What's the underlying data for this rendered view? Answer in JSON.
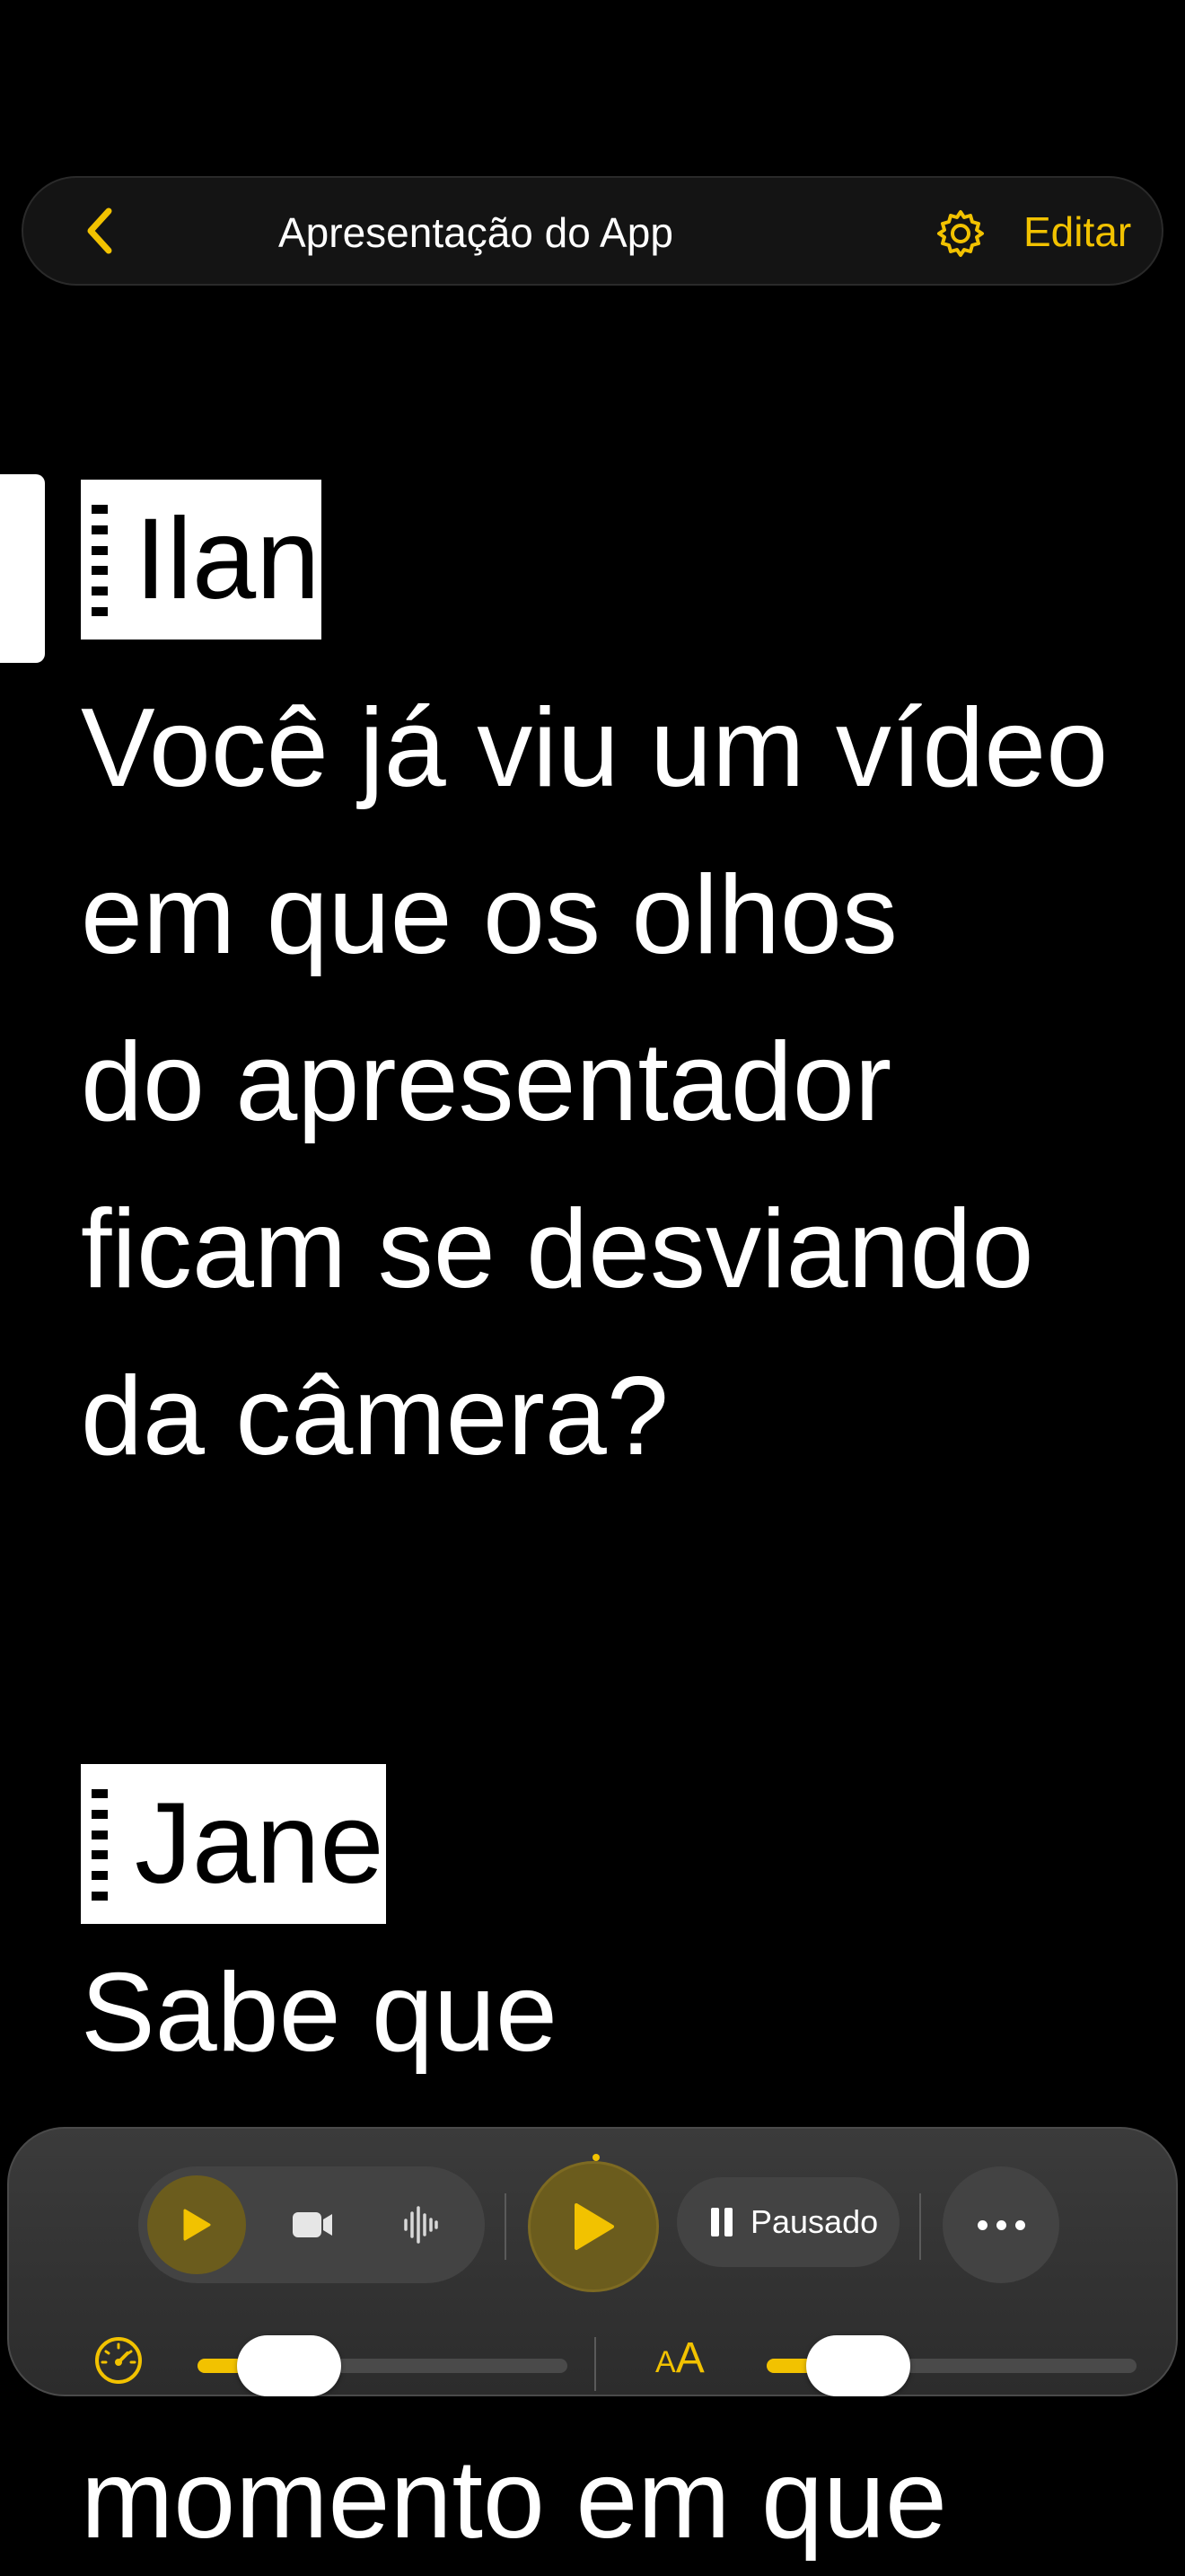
{
  "nav": {
    "title": "Apresentação do App",
    "edit_label": "Editar",
    "accent": "#f2c200"
  },
  "script": {
    "speaker1": "Ilan",
    "speaker1_lines": [
      "Você já viu um vídeo",
      "em que os olhos",
      "do apresentador",
      "ficam se desviando",
      "da câmera?"
    ],
    "speaker2": "Jane",
    "speaker2_lines": [
      "Sabe que"
    ],
    "tail_line": "momento em que"
  },
  "controls": {
    "status_label": "Pausado",
    "speed_level": 0.15,
    "text_size_level": 0.15,
    "size_icon_small": "A",
    "size_icon_big": "A",
    "icons": [
      "chevron-left-icon",
      "gear-icon",
      "play-icon",
      "camera-icon",
      "waveform-icon",
      "pause-icon",
      "ellipsis-icon",
      "speedometer-icon",
      "text-size-icon"
    ]
  }
}
